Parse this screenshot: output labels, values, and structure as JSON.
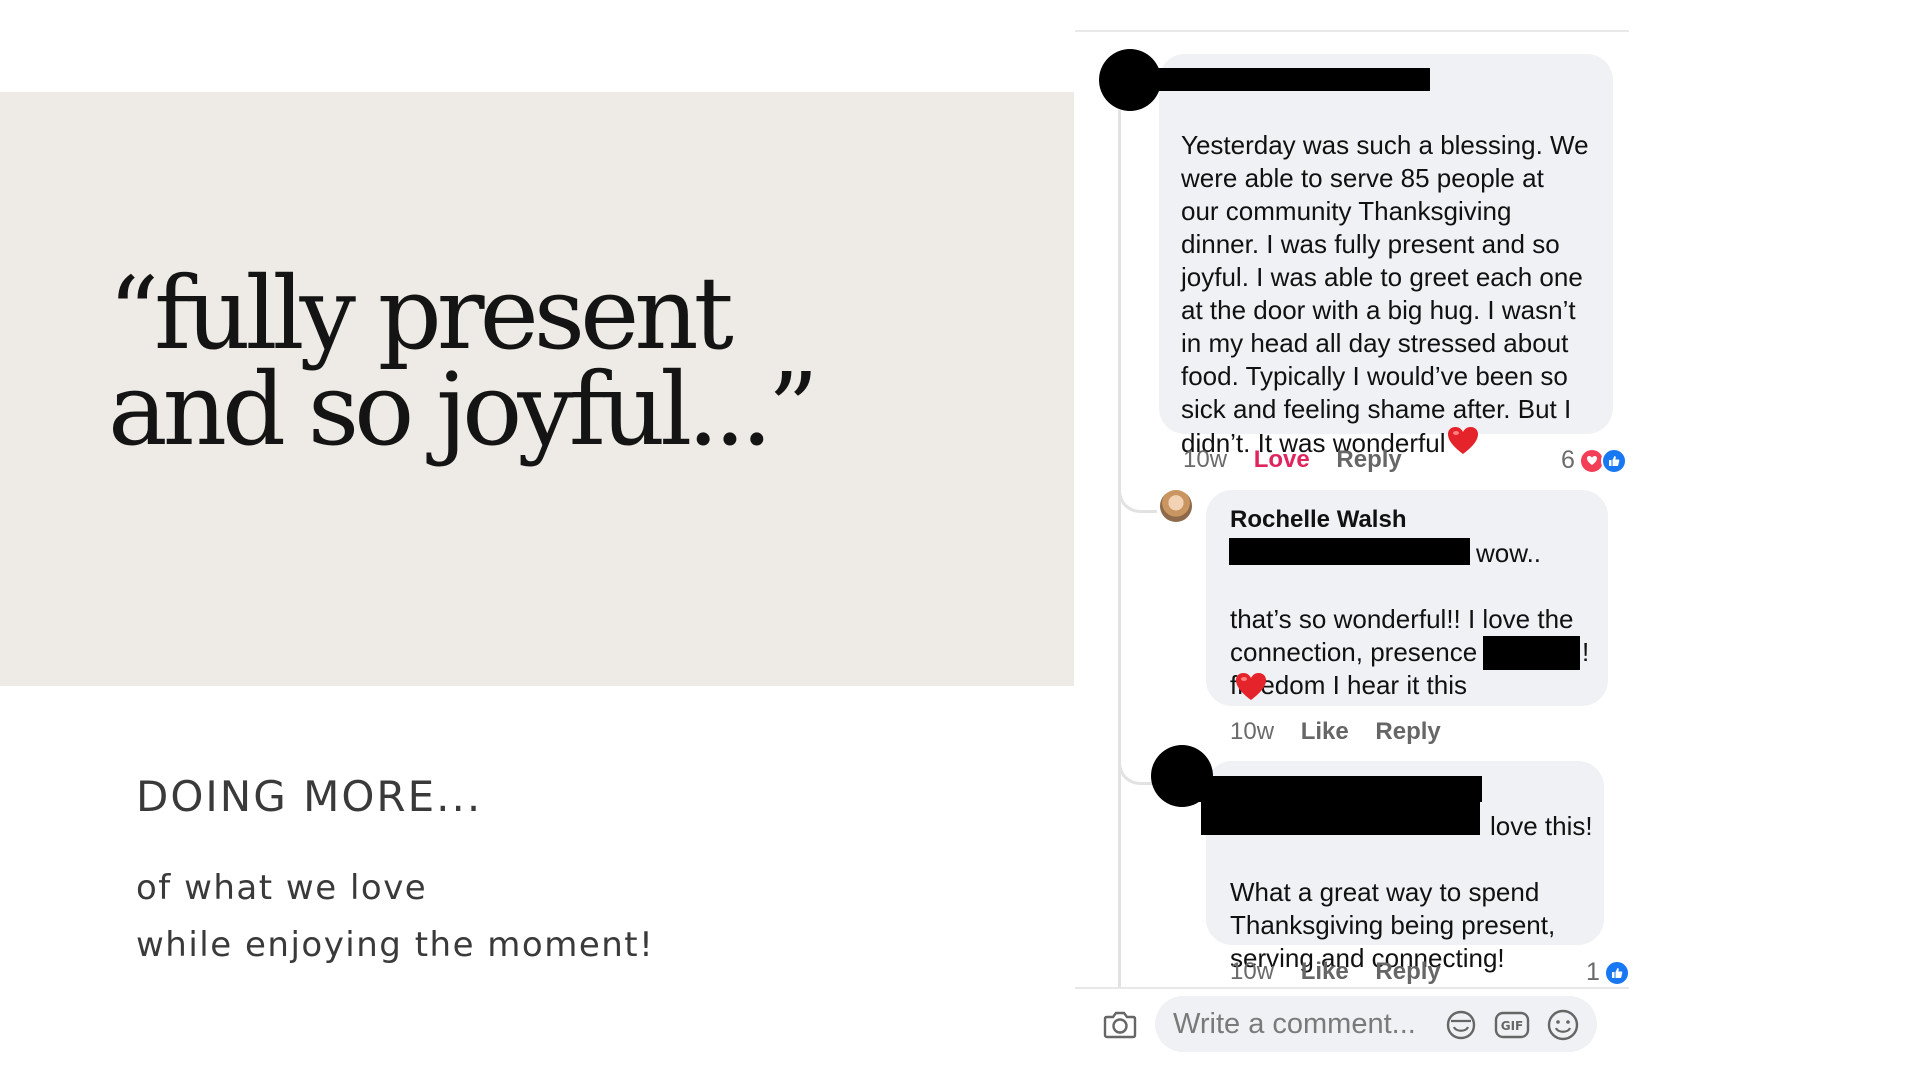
{
  "slide": {
    "quote": "“fully present\nand so joyful...”",
    "heading": "DOING MORE...",
    "line1": "of what we love",
    "line2": "while enjoying the moment!"
  },
  "comments": [
    {
      "text": "Yesterday was such a blessing. We\nwere able to serve 85 people at\nour community Thanksgiving\ndinner. I was fully present and so\njoyful. I was able to greet each one\nat the door with a big hug. I wasn’t\nin my head all day stressed about\nfood. Typically I would’ve been so\nsick and feeling shame after. But I\ndidn’t. It was wonderful",
      "time": "10w",
      "reaction_label": "Love",
      "reply_label": "Reply",
      "reaction_count": "6"
    },
    {
      "author": "Rochelle Walsh",
      "text_after_redaction": "wow..",
      "text": "that’s so wonderful!!  I love the\nconnection, presence and\nfreedom I hear it this",
      "text_end": "!",
      "time": "10w",
      "like_label": "Like",
      "reply_label": "Reply"
    },
    {
      "text_after_redaction": "love this!",
      "text": "What a great way to spend\nThanksgiving being present,\nserving and connecting!",
      "time": "10w",
      "like_label": "Like",
      "reply_label": "Reply",
      "reaction_count": "1"
    }
  ],
  "composer": {
    "placeholder": "Write a comment...",
    "icons": [
      "camera-icon",
      "sticker-icon",
      "gif-icon",
      "emoji-icon"
    ]
  },
  "colors": {
    "beige": "#eeebe6",
    "bubble": "#eff1f4",
    "love": "#e0245e",
    "like_blue": "#1877f2"
  }
}
